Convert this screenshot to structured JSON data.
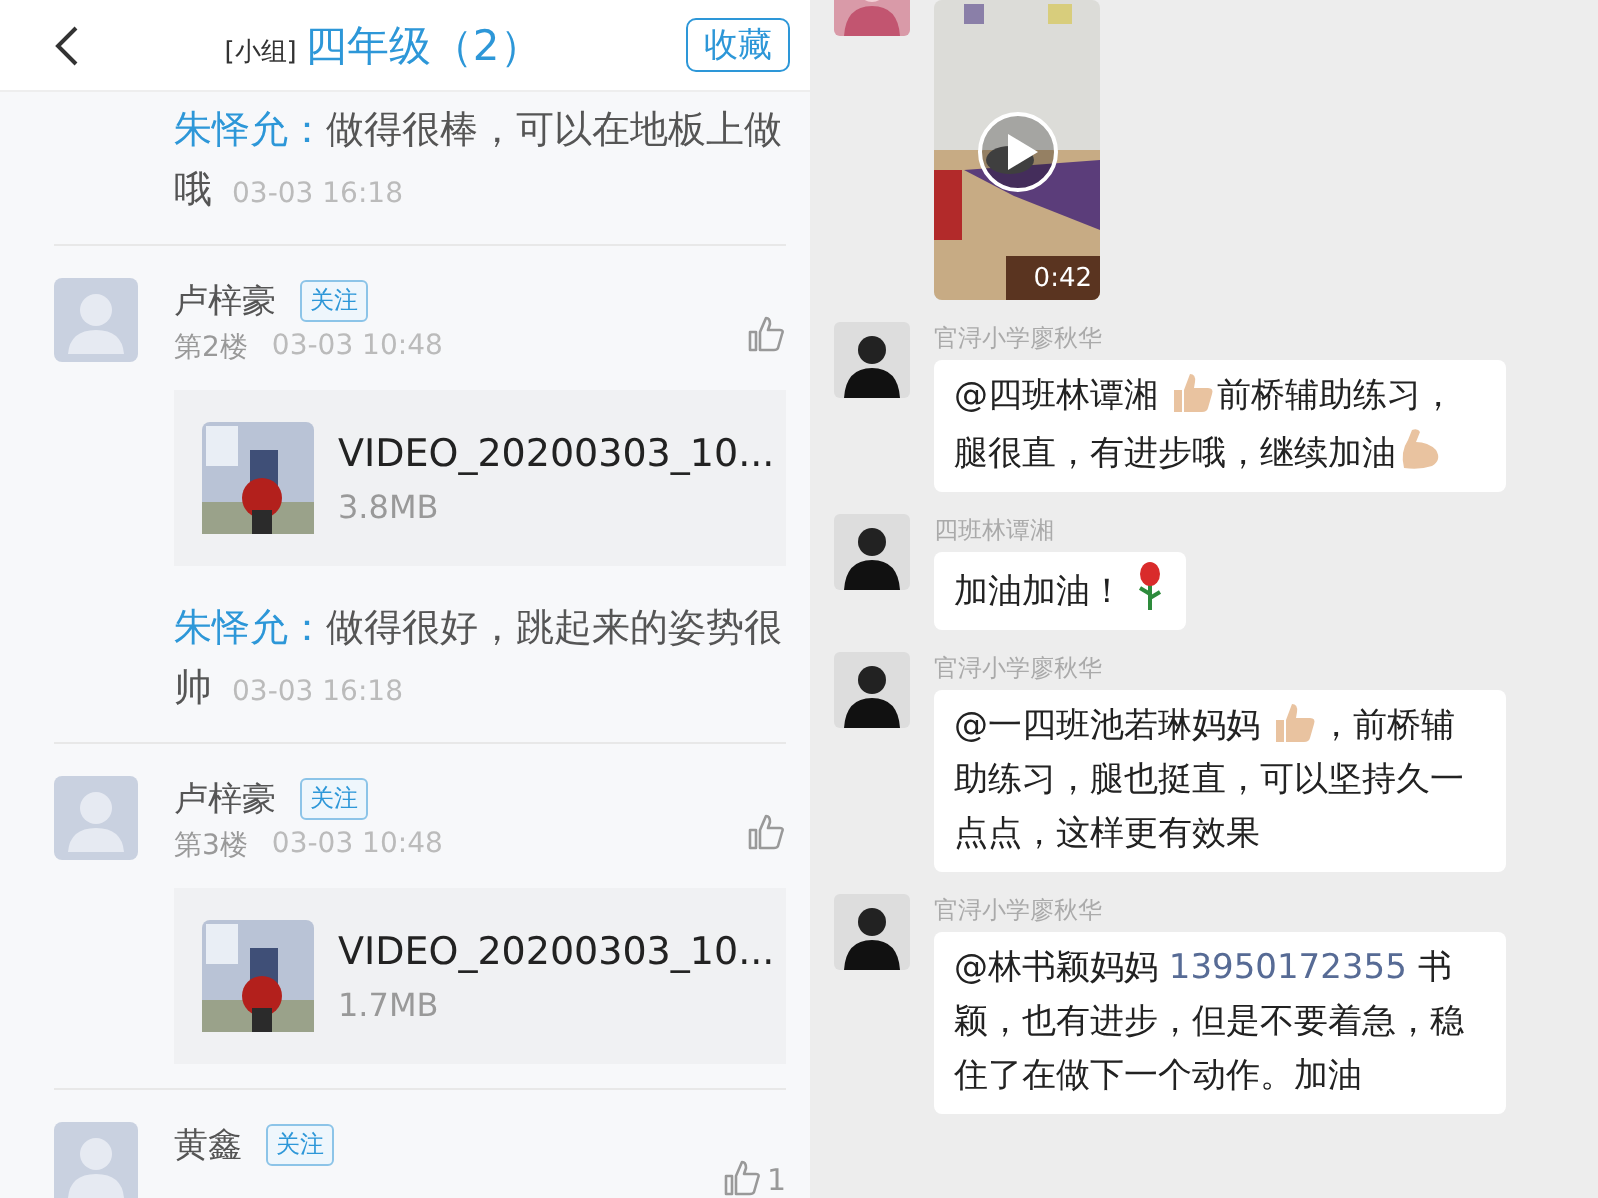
{
  "left": {
    "header": {
      "group_tag": "[小组]",
      "title": "四年级（2）",
      "favorite_button": "收藏"
    },
    "thread": [
      {
        "kind": "reply",
        "author": "朱怿允：",
        "text": "做得很棒，可以在地板上做哦",
        "time": "03-03 16:18"
      },
      {
        "kind": "post",
        "name": "卢梓豪",
        "follow": "关注",
        "floor": "第2楼",
        "time": "03-03 10:48",
        "attachment": {
          "file_name": "VIDEO_20200303_10...",
          "size": "3.8MB"
        }
      },
      {
        "kind": "reply",
        "author": "朱怿允：",
        "text": "做得很好，跳起来的姿势很帅",
        "time": "03-03 16:18"
      },
      {
        "kind": "post",
        "name": "卢梓豪",
        "follow": "关注",
        "floor": "第3楼",
        "time": "03-03 10:48",
        "attachment": {
          "file_name": "VIDEO_20200303_10...",
          "size": "1.7MB"
        }
      },
      {
        "kind": "post",
        "name": "黄鑫",
        "follow": "关注",
        "like_count": "1"
      }
    ]
  },
  "right": {
    "messages": [
      {
        "kind": "video",
        "duration": "0:42"
      },
      {
        "kind": "text",
        "sender": "官浔小学廖秋华",
        "parts": [
          {
            "kind": "text",
            "text": "@四班林谭湘 "
          },
          {
            "kind": "thumb"
          },
          {
            "kind": "text",
            "text": "前桥辅助练习，腿很直，有进步哦，继续加油"
          },
          {
            "kind": "arm"
          }
        ]
      },
      {
        "kind": "text",
        "sender": "四班林谭湘",
        "parts": [
          {
            "kind": "text",
            "text": "加油加油！ "
          },
          {
            "kind": "rose"
          }
        ]
      },
      {
        "kind": "text",
        "sender": "官浔小学廖秋华",
        "parts": [
          {
            "kind": "text",
            "text": "@一四班池若琳妈妈 "
          },
          {
            "kind": "thumb"
          },
          {
            "kind": "text",
            "text": "，前桥辅助练习，腿也挺直，可以坚持久一点点，这样更有效果"
          }
        ]
      },
      {
        "kind": "text",
        "sender": "官浔小学廖秋华",
        "parts": [
          {
            "kind": "text",
            "text": "@林书颖妈妈 "
          },
          {
            "kind": "link",
            "text": "13950172355"
          },
          {
            "kind": "text",
            "text": " 书颖，也有进步，但是不要着急，稳住了在做下一个动作。加油"
          }
        ]
      }
    ]
  }
}
